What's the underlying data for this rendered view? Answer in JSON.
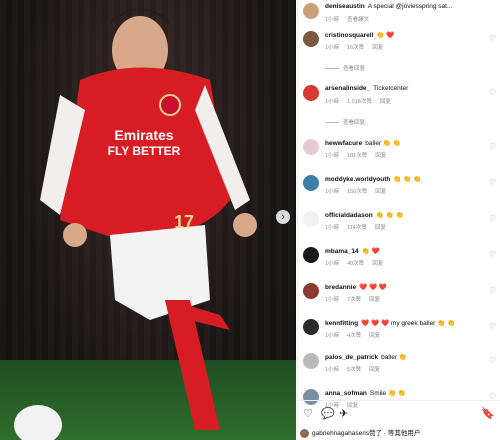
{
  "post_image": {
    "sponsor_line1": "Emirates",
    "sponsor_line2": "FLY BETTER",
    "shirt_number": "17",
    "next_icon": "chevron-right-icon"
  },
  "comments": [
    {
      "username": "deniseaustin",
      "text": "A special @joviesspring sat...",
      "time": "1小時",
      "action": "查看譯文",
      "avatar_color": "#c9a27a"
    },
    {
      "username": "cristinosquarell",
      "text": "👏 ❤️",
      "time": "1小時",
      "likes": "16次赞",
      "action": "回复",
      "avatar_color": "#7b5a44"
    },
    {
      "username": "arsenalinside_",
      "text": "Ticketcenter",
      "time": "1小時",
      "likes": "1,018次赞",
      "action": "回复",
      "avatar_color": "#d43a2f"
    },
    {
      "username": "hewwfacure",
      "text": "baller 👏 👏",
      "time": "1小時",
      "likes": "181次赞",
      "action": "回复",
      "avatar_color": "#e9c8d6"
    },
    {
      "username": "moddyke.worldyouth",
      "text": "👏 👏 👏",
      "time": "1小時",
      "likes": "150次赞",
      "action": "回复",
      "avatar_color": "#3b7ea8"
    },
    {
      "username": "officialdadason",
      "text": "👏 👏 👏",
      "time": "1小時",
      "likes": "114次赞",
      "action": "回复",
      "avatar_color": "#f1f1f1"
    },
    {
      "username": "mbama_14",
      "text": "👏 ❤️",
      "time": "1小時",
      "likes": "40次赞",
      "action": "回复",
      "avatar_color": "#1a1a1a"
    },
    {
      "username": "bredannie",
      "text": "❤️ ❤️ ❤️",
      "time": "1小時",
      "likes": "7次赞",
      "action": "回复",
      "avatar_color": "#8b3a2f"
    },
    {
      "username": "kennfitting",
      "text": "❤️ ❤️ ❤️ my greek baller 👏 👏",
      "time": "1小時",
      "likes": "4次赞",
      "action": "回复",
      "avatar_color": "#2a2a2a"
    },
    {
      "username": "palos_de_patrick",
      "text": "baller 👏",
      "time": "1小時",
      "likes": "5次赞",
      "action": "回复",
      "avatar_color": "#b9b9b9"
    },
    {
      "username": "anna_sofman",
      "text": "Smile 👏 👏",
      "time": "1小時",
      "likes": "",
      "action": "回复",
      "avatar_color": "#7a8fa6"
    }
  ],
  "replies_label": "查看回复",
  "actions": {
    "like": "♡",
    "comment": "💬",
    "share": "✈",
    "save": "🔖"
  },
  "liked_by": "gabriehnagahaseris赞了 · 等其他用户"
}
